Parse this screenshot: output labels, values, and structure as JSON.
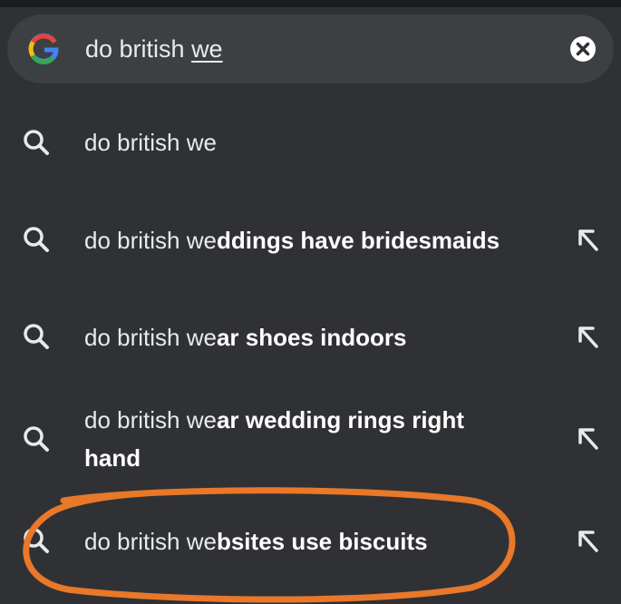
{
  "search": {
    "typed_prefix": "do british ",
    "typed_underlined": "we",
    "google_icon": "google-g-logo",
    "clear_icon": "close-circle-icon"
  },
  "suggestions": [
    {
      "prefix": "do british we",
      "completion": ""
    },
    {
      "prefix": "do british we",
      "completion": "ddings have bridesmaids"
    },
    {
      "prefix": "do british we",
      "completion": "ar shoes indoors"
    },
    {
      "prefix": "do british we",
      "completion": "ar wedding rings right hand"
    },
    {
      "prefix": "do british we",
      "completion": "bsites use biscuits"
    }
  ],
  "icons": {
    "search": "search-icon",
    "fill": "arrow-up-left-icon"
  },
  "colors": {
    "background": "#303134",
    "searchbar": "#3c4043",
    "text": "#e8eaed",
    "annotation": "#e8782a"
  }
}
